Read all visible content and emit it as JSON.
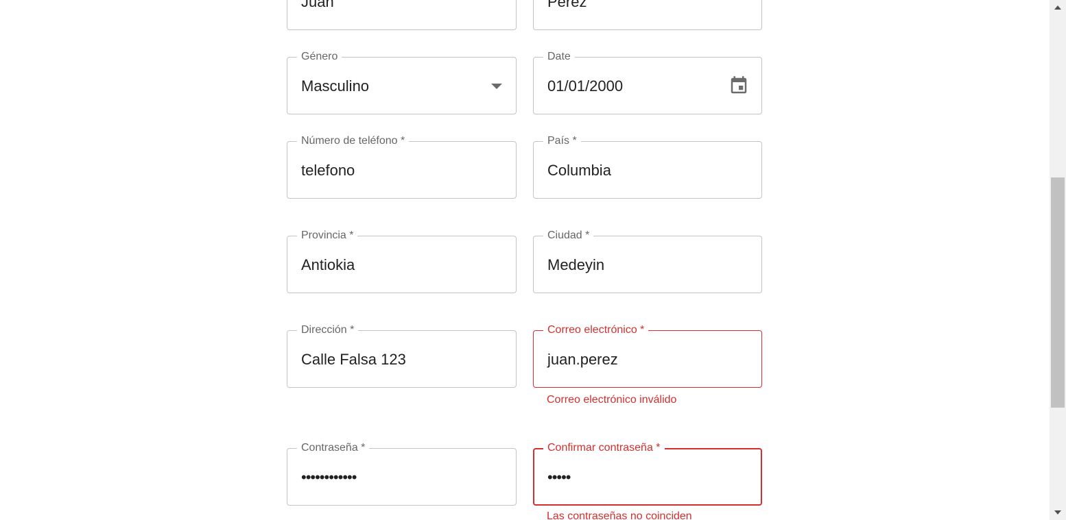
{
  "form": {
    "first_name": {
      "value": "Juan"
    },
    "last_name": {
      "value": "Perez"
    },
    "gender": {
      "label": "Género",
      "value": "Masculino",
      "icon": "chevron-down-icon"
    },
    "date": {
      "label": "Date",
      "value": "01/01/2000",
      "icon": "calendar-icon"
    },
    "phone": {
      "label": "Número de teléfono *",
      "value": "telefono"
    },
    "country": {
      "label": "País *",
      "value": "Columbia"
    },
    "province": {
      "label": "Provincia *",
      "value": "Antiokia"
    },
    "city": {
      "label": "Ciudad *",
      "value": "Medeyin"
    },
    "address": {
      "label": "Dirección *",
      "value": "Calle Falsa 123"
    },
    "email": {
      "label": "Correo electrónico *",
      "value": "juan.perez",
      "error": "Correo electrónico inválido"
    },
    "password": {
      "label": "Contraseña *",
      "value": "••••••••••••"
    },
    "confirm_password": {
      "label": "Confirmar contraseña *",
      "value": "•••••",
      "error": "Las contraseñas no coinciden"
    }
  },
  "colors": {
    "error": "#d32f2f",
    "border": "#c4c4c4",
    "label": "#666666",
    "text": "#212121"
  }
}
